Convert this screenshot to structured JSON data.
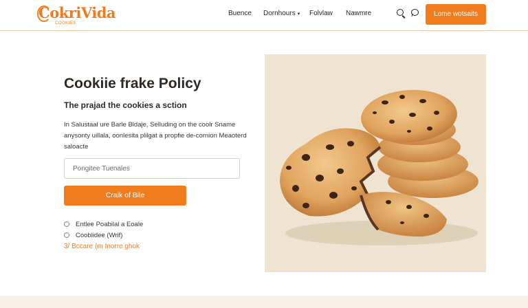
{
  "header": {
    "logo": {
      "name": "CokriVida",
      "tagline": "COOKIES"
    },
    "nav": [
      {
        "label": "Buence",
        "has_dropdown": false
      },
      {
        "label": "Dornhours",
        "has_dropdown": true
      },
      {
        "label": "Folvlaw",
        "has_dropdown": false
      },
      {
        "label": "Nawmre",
        "has_dropdown": false
      }
    ],
    "icons": [
      "search-icon",
      "chat-bubble-icon"
    ],
    "cta_label": "Lome wotsaits"
  },
  "main": {
    "title": "Cookiie frake Policy",
    "subtitle": "The prajad the cookies a sction",
    "body": "In Salustaal ure Barle Bldaje, Selluding on the coolr Sname anysonty uillala, oonlesita plilgat a propfie de-cornion Meaoterd saloacte",
    "input_placeholder": "Pongitee Tuenales",
    "primary_button": "Craik of Bile",
    "options": [
      {
        "label": "Entlee Poabilal a Eoale",
        "checked": false
      },
      {
        "label": "Cooblidee (Wrif)",
        "checked": false
      }
    ],
    "link": "3/ Bccare (m Inorre ghok"
  },
  "colors": {
    "accent": "#f07c1d",
    "text": "#2f2925",
    "image_bg": "#efe3d2",
    "divider": "#f0c9a8"
  }
}
